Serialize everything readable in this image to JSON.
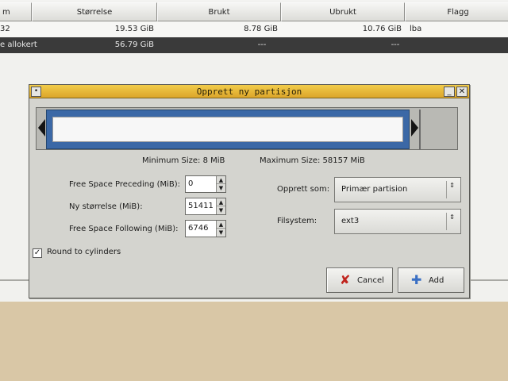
{
  "table": {
    "columns": [
      "m",
      "Størrelse",
      "Brukt",
      "Ubrukt",
      "Flagg"
    ],
    "rows": [
      {
        "partition": "32",
        "size": "19.53 GiB",
        "used": "8.78 GiB",
        "unused": "10.76 GiB",
        "flags": "lba"
      },
      {
        "partition": "e allokert",
        "size": "56.79 GiB",
        "used": "---",
        "unused": "---",
        "flags": ""
      }
    ]
  },
  "dialog": {
    "title": "Opprett ny partisjon",
    "menu_glyph": "•",
    "minimize_glyph": "_",
    "close_glyph": "✕",
    "min_size": "Minimum Size: 8 MiB",
    "max_size": "Maximum Size: 58157 MiB",
    "fields": {
      "preceding_label": "Free Space Preceding (MiB):",
      "preceding_value": "0",
      "new_size_label": "Ny størrelse (MiB):",
      "new_size_value": "51411",
      "following_label": "Free Space Following (MiB):",
      "following_value": "6746"
    },
    "create_as_label": "Opprett som:",
    "create_as_value": "Primær partision",
    "filesystem_label": "Filsystem:",
    "filesystem_value": "ext3",
    "round_label": "Round to cylinders",
    "round_checked": true,
    "cancel_label": "Cancel",
    "add_label": "Add",
    "icons": {
      "cancel": "x-icon",
      "add": "plus-icon",
      "spin_up": "▲",
      "spin_down": "▼",
      "combo": "⇕",
      "check": "✓"
    },
    "colors": {
      "titlebar": "#e2b232",
      "partition_fill": "#3b68a6",
      "cancel_icon": "#c0251e",
      "add_icon": "#3a6fc4"
    }
  }
}
